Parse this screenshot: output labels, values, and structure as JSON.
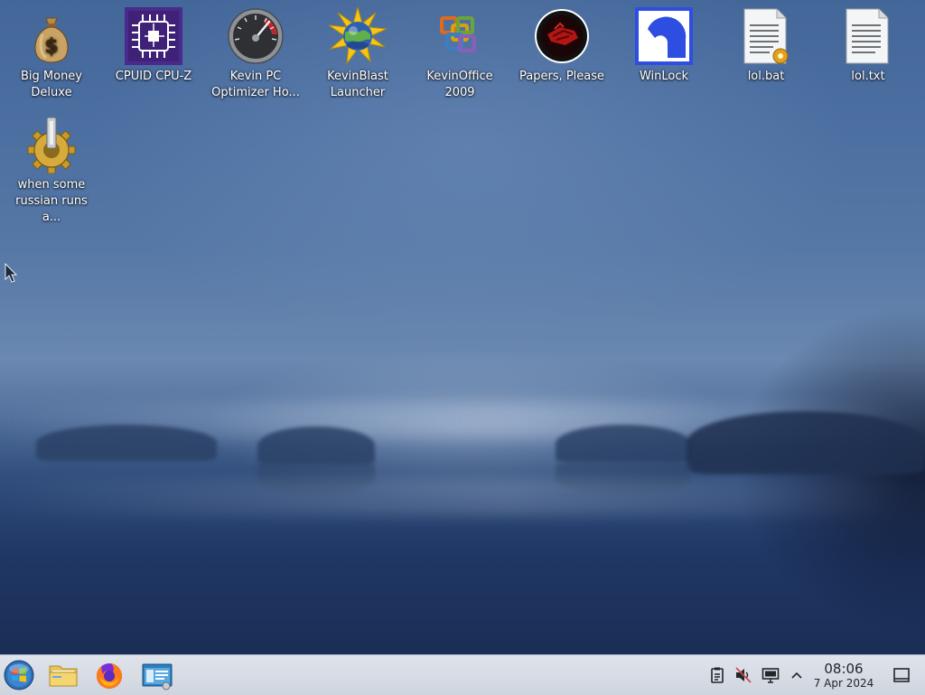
{
  "desktop": {
    "icons": [
      {
        "label": "Big Money\nDeluxe",
        "icon": "money-bag-icon"
      },
      {
        "label": "CPUID CPU-Z",
        "icon": "cpu-chip-icon"
      },
      {
        "label": "Kevin PC\nOptimizer Ho...",
        "icon": "speedometer-icon"
      },
      {
        "label": "KevinBlast\nLauncher",
        "icon": "starburst-globe-icon"
      },
      {
        "label": "KevinOffice\n2009",
        "icon": "office-logo-icon"
      },
      {
        "label": "Papers, Please",
        "icon": "papers-please-seal-icon"
      },
      {
        "label": "WinLock",
        "icon": "winlock-icon"
      },
      {
        "label": "lol.bat",
        "icon": "batch-file-icon"
      },
      {
        "label": "lol.txt",
        "icon": "text-file-icon"
      },
      {
        "label": "when some\nrussian runs a...",
        "icon": "gear-icon"
      }
    ]
  },
  "taskbar": {
    "start": {
      "icon": "start-orb-icon"
    },
    "pinned": [
      {
        "name": "File Manager",
        "icon": "folder-icon"
      },
      {
        "name": "Firefox",
        "icon": "firefox-icon"
      },
      {
        "name": "System Settings",
        "icon": "settings-window-icon"
      }
    ],
    "tray": [
      {
        "icon": "clipboard-icon"
      },
      {
        "icon": "volume-muted-icon"
      },
      {
        "icon": "display-icon"
      },
      {
        "icon": "chevron-up-icon"
      }
    ],
    "clock": {
      "time": "08:06",
      "date": "7 Apr 2024"
    },
    "show_desktop_icon": "show-desktop-icon"
  },
  "colors": {
    "taskbar_bg": "#d6dbe3",
    "desktop_top": "#44679a",
    "desktop_bottom": "#1a2d55",
    "icon_text": "#ffffff"
  }
}
